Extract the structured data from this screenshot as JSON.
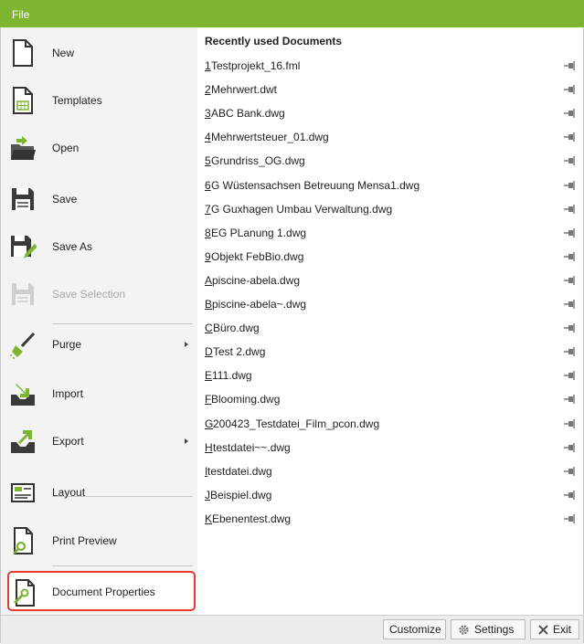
{
  "window": {
    "title": "File"
  },
  "sidebar": {
    "items": [
      {
        "label": "New",
        "icon": "new-document-icon"
      },
      {
        "label": "Templates",
        "icon": "templates-icon"
      },
      {
        "label": "Open",
        "icon": "open-folder-icon"
      },
      {
        "label": "Save",
        "icon": "save-icon"
      },
      {
        "label": "Save As",
        "icon": "save-as-icon"
      },
      {
        "label": "Save Selection",
        "icon": "save-selection-icon"
      },
      {
        "label": "Purge",
        "icon": "purge-broom-icon"
      },
      {
        "label": "Import",
        "icon": "import-icon"
      },
      {
        "label": "Export",
        "icon": "export-icon"
      },
      {
        "label": "Layout",
        "icon": "layout-icon"
      },
      {
        "label": "Print Preview",
        "icon": "print-preview-icon"
      },
      {
        "label": "Document Properties",
        "icon": "document-properties-icon"
      }
    ]
  },
  "recent": {
    "header": "Recently used Documents",
    "items": [
      {
        "key": "1",
        "name": " Testprojekt_16.fml"
      },
      {
        "key": "2",
        "name": " Mehrwert.dwt"
      },
      {
        "key": "3",
        "name": " ABC Bank.dwg"
      },
      {
        "key": "4",
        "name": " Mehrwertsteuer_01.dwg"
      },
      {
        "key": "5",
        "name": " Grundriss_OG.dwg"
      },
      {
        "key": "6",
        "name": " G Wüstensachsen Betreuung Mensa1.dwg"
      },
      {
        "key": "7",
        "name": " G Guxhagen Umbau Verwaltung.dwg"
      },
      {
        "key": "8",
        "name": " EG PLanung 1.dwg"
      },
      {
        "key": "9",
        "name": " Objekt FebBio.dwg"
      },
      {
        "key": "A",
        "name": " piscine-abela.dwg"
      },
      {
        "key": "B",
        "name": " piscine-abela~.dwg"
      },
      {
        "key": "C",
        "name": " Büro.dwg"
      },
      {
        "key": "D",
        "name": " Test 2.dwg"
      },
      {
        "key": "E",
        "name": " 111.dwg"
      },
      {
        "key": "F",
        "name": " Blooming.dwg"
      },
      {
        "key": "G",
        "name": " 200423_Testdatei_Film_pcon.dwg"
      },
      {
        "key": "H",
        "name": " testdatei~~.dwg"
      },
      {
        "key": "I",
        "name": " testdatei.dwg"
      },
      {
        "key": "J",
        "name": " Beispiel.dwg"
      },
      {
        "key": "K",
        "name": " Ebenentest.dwg"
      }
    ]
  },
  "footer": {
    "customize": "Customize",
    "settings": "Settings",
    "exit": "Exit"
  },
  "colors": {
    "accent": "#7eb530",
    "selection_border": "#e53935"
  }
}
